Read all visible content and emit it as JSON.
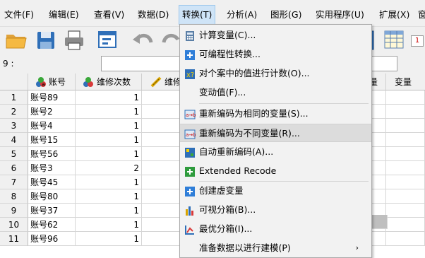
{
  "menubar": {
    "items": [
      {
        "label": "文件(F)"
      },
      {
        "label": "编辑(E)"
      },
      {
        "label": "查看(V)"
      },
      {
        "label": "数据(D)"
      },
      {
        "label": "转换(T)",
        "active": true
      },
      {
        "label": "分析(A)"
      },
      {
        "label": "图形(G)"
      },
      {
        "label": "实用程序(U)"
      },
      {
        "label": "扩展(X)"
      },
      {
        "label": "窗"
      }
    ]
  },
  "toolbar": {
    "icons": [
      "open-folder-icon",
      "save-icon",
      "print-icon",
      "dialog-recall-icon",
      "undo-icon",
      "redo-icon",
      "go-to-case-icon",
      "table-icon"
    ],
    "badge": "1"
  },
  "cell_editor": {
    "label": "9 :",
    "value": ""
  },
  "grid": {
    "columns": [
      {
        "label": "账号",
        "icon": "nominal-variable-icon"
      },
      {
        "label": "维修次数",
        "icon": "nominal-variable-icon"
      },
      {
        "label": "维修",
        "icon": "scale-variable-icon"
      },
      {
        "label": "量"
      },
      {
        "label": "变量"
      }
    ],
    "rows": [
      {
        "num": "1",
        "account": "账号89",
        "count": "1"
      },
      {
        "num": "2",
        "account": "账号2",
        "count": "1"
      },
      {
        "num": "3",
        "account": "账号4",
        "count": "1"
      },
      {
        "num": "4",
        "account": "账号15",
        "count": "1"
      },
      {
        "num": "5",
        "account": "账号56",
        "count": "1"
      },
      {
        "num": "6",
        "account": "账号3",
        "count": "2"
      },
      {
        "num": "7",
        "account": "账号45",
        "count": "1"
      },
      {
        "num": "8",
        "account": "账号80",
        "count": "1"
      },
      {
        "num": "9",
        "account": "账号37",
        "count": "1"
      },
      {
        "num": "10",
        "account": "账号62",
        "count": "1"
      },
      {
        "num": "11",
        "account": "账号96",
        "count": "1"
      }
    ]
  },
  "transform_menu": {
    "items": [
      {
        "label": "计算变量(C)...",
        "icon": "calculator-icon"
      },
      {
        "label": "可编程性转换...",
        "icon": "plus-icon"
      },
      {
        "label": "对个案中的值进行计数(O)...",
        "icon": "count-values-icon"
      },
      {
        "label": "变动值(F)...",
        "icon": ""
      },
      {
        "label": "重新编码为相同的变量(S)...",
        "icon": "recode-same-icon"
      },
      {
        "label": "重新编码为不同变量(R)...",
        "icon": "recode-different-icon",
        "hover": true
      },
      {
        "label": "自动重新编码(A)...",
        "icon": "auto-recode-icon"
      },
      {
        "label": "Extended Recode",
        "icon": "green-plus-icon"
      },
      {
        "label": "创建虚变量",
        "icon": "plus-icon"
      },
      {
        "label": "可视分箱(B)...",
        "icon": "visual-binning-icon"
      },
      {
        "label": "最优分箱(I)...",
        "icon": "optimal-binning-icon"
      },
      {
        "label": "准备数据以进行建模(P)",
        "icon": "",
        "submenu": true
      }
    ]
  },
  "colors": {
    "menu_active": "#cfe4f7",
    "menu_hover": "#dcdcdc",
    "selected_cell": "#bfbfbf",
    "icon_blue": "#2f7ed8"
  }
}
